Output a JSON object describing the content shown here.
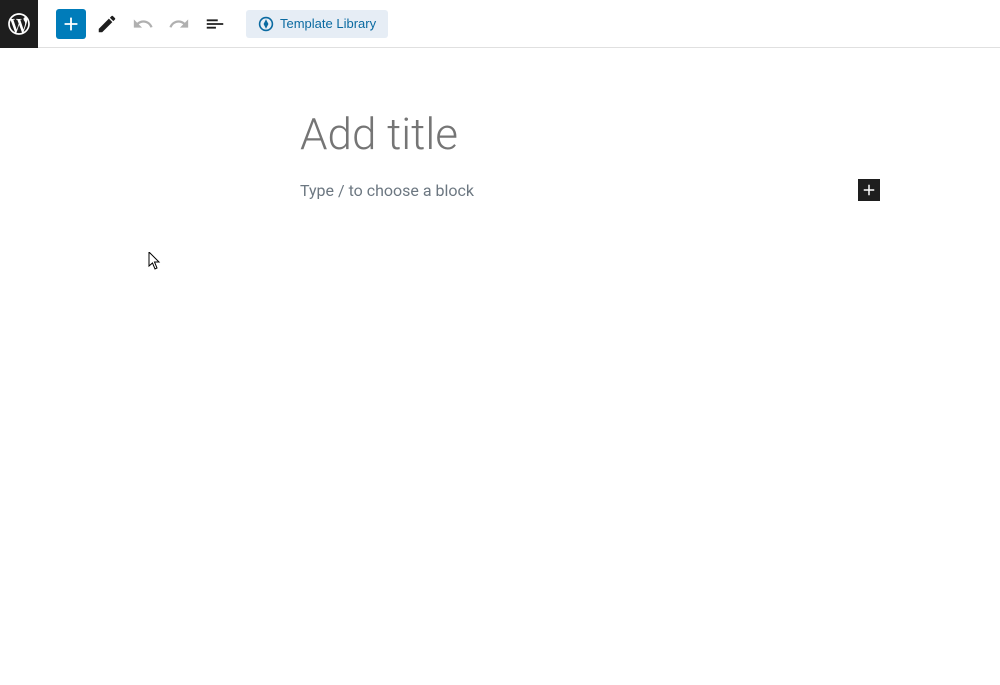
{
  "toolbar": {
    "template_library_label": "Template Library"
  },
  "editor": {
    "title_placeholder": "Add title",
    "block_placeholder": "Type / to choose a block"
  }
}
